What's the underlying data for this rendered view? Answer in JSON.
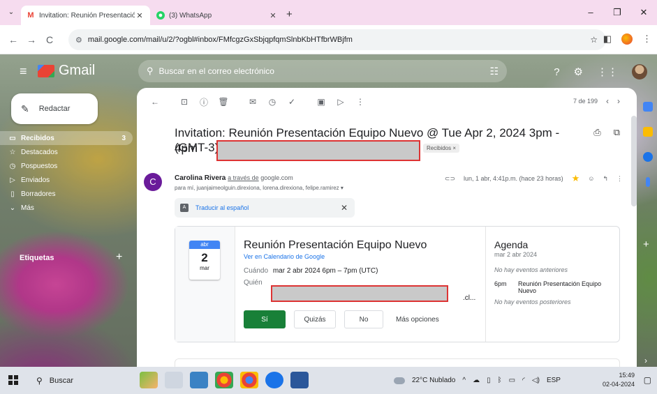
{
  "browser": {
    "tabs": [
      {
        "title": "Invitation: Reunión Presentación",
        "favicon": "gmail-icon"
      },
      {
        "title": "(3) WhatsApp",
        "favicon": "whatsapp-icon"
      }
    ],
    "url": "mail.google.com/mail/u/2/?ogbl#inbox/FMfcgzGxSbjqpfqmSlnbKbHTfbrWBjfm"
  },
  "gmail": {
    "logo_text": "Gmail",
    "search_placeholder": "Buscar en el correo electrónico",
    "compose_label": "Redactar",
    "nav": [
      {
        "label": "Recibidos",
        "count": "3",
        "icon": "inbox-icon"
      },
      {
        "label": "Destacados",
        "count": "",
        "icon": "star-icon"
      },
      {
        "label": "Pospuestos",
        "count": "",
        "icon": "clock-icon"
      },
      {
        "label": "Enviados",
        "count": "",
        "icon": "send-icon"
      },
      {
        "label": "Borradores",
        "count": "",
        "icon": "draft-icon"
      },
      {
        "label": "Más",
        "count": "",
        "icon": "chevron-down-icon"
      }
    ],
    "labels_header": "Etiquetas",
    "pager_text": "7 de 199"
  },
  "message": {
    "subject": "Invitation: Reunión Presentación Equipo Nuevo @ Tue Apr 2, 2024 3pm - 4pm",
    "subject_tz": "(GMT-3)",
    "inbox_chip": "Recibidos ×",
    "sender_initial": "C",
    "sender_name": "Carolina Rivera",
    "via_text": "a través de",
    "via_domain": "google.com",
    "to_line": "para mí, juanjaimeolguin.direxiona, lorena.direxiona, felipe.ramirez ▾",
    "date_text": "lun, 1 abr, 4:41p.m. (hace 23 horas)",
    "translate_label": "Traducir al español"
  },
  "invite": {
    "month": "abr",
    "day": "2",
    "weekday": "mar",
    "title": "Reunión Presentación Equipo Nuevo",
    "calendar_link": "Ver en Calendario de Google",
    "when_label": "Cuándo",
    "when_value": "mar 2 abr 2024 6pm – 7pm (UTC)",
    "who_label": "Quién",
    "who_tail": ".cl...",
    "btn_yes": "Sí",
    "btn_maybe": "Quizás",
    "btn_no": "No",
    "btn_more": "Más opciones",
    "agenda_title": "Agenda",
    "agenda_date": "mar 2 abr 2024",
    "agenda_prev": "No hay eventos anteriores",
    "agenda_time": "6pm",
    "agenda_event": "Reunión Presentación Equipo Nuevo",
    "agenda_next": "No hay eventos posteriores"
  },
  "taskbar": {
    "search": "Buscar",
    "weather": "22°C Nublado",
    "lang": "ESP",
    "time": "15:49",
    "date": "02-04-2024"
  },
  "colors": {
    "accept_green": "#188038",
    "link_blue": "#1a73e8",
    "redaction_border": "#dd3333"
  }
}
